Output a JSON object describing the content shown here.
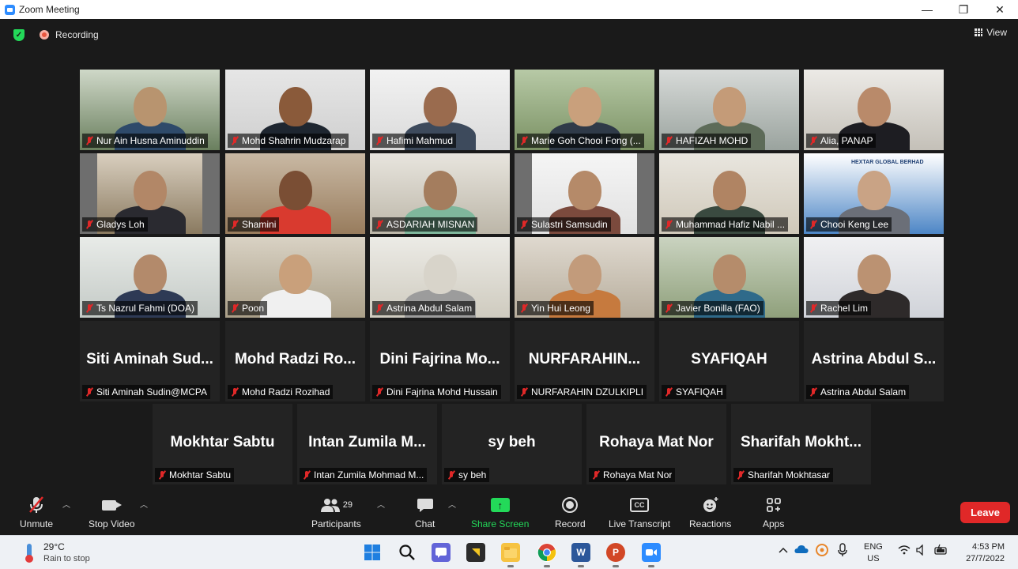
{
  "window": {
    "title": "Zoom Meeting",
    "minimize": "—",
    "maximize": "❐",
    "close": "✕"
  },
  "header": {
    "recording_label": "Recording",
    "view_label": "View"
  },
  "video_tiles": [
    {
      "name": "Nur Ain Husna Aminuddin",
      "active": true
    },
    {
      "name": "Mohd Shahrin Mudzarap"
    },
    {
      "name": "Hafimi Mahmud"
    },
    {
      "name": "Marie Goh Chooi Fong (..."
    },
    {
      "name": "HAFIZAH MOHD"
    },
    {
      "name": "Alia, PANAP"
    },
    {
      "name": "Gladys Loh"
    },
    {
      "name": "Shamini"
    },
    {
      "name": "ASDARIAH MISNAN"
    },
    {
      "name": "Sulastri Samsudin"
    },
    {
      "name": "Muhammad Hafiz Nabil ..."
    },
    {
      "name": "Chooi Keng Lee",
      "banner": "HEXTAR GLOBAL BERHAD"
    },
    {
      "name": "Ts Nazrul Fahmi (DOA)"
    },
    {
      "name": "Poon"
    },
    {
      "name": "Astrina Abdul Salam"
    },
    {
      "name": "Yin Hui Leong"
    },
    {
      "name": "Javier Bonilla (FAO)"
    },
    {
      "name": "Rachel Lim"
    }
  ],
  "name_tiles": [
    {
      "display": "Siti Aminah Sud...",
      "name": "Siti Aminah Sudin@MCPA"
    },
    {
      "display": "Mohd Radzi Ro...",
      "name": "Mohd Radzi Rozihad"
    },
    {
      "display": "Dini Fajrina Mo...",
      "name": "Dini Fajrina Mohd Hussain"
    },
    {
      "display": "NURFARAHIN...",
      "name": "NURFARAHIN DZULKIPLI"
    },
    {
      "display": "SYAFIQAH",
      "name": "SYAFIQAH"
    },
    {
      "display": "Astrina Abdul S...",
      "name": "Astrina Abdul Salam"
    },
    {
      "display": "Mokhtar Sabtu",
      "name": "Mokhtar Sabtu"
    },
    {
      "display": "Intan Zumila M...",
      "name": "Intan Zumila Mohmad M..."
    },
    {
      "display": "sy beh",
      "name": "sy beh"
    },
    {
      "display": "Rohaya Mat Nor",
      "name": "Rohaya Mat Nor"
    },
    {
      "display": "Sharifah Mokht...",
      "name": "Sharifah Mokhtasar"
    }
  ],
  "toolbar": {
    "unmute": "Unmute",
    "stop_video": "Stop Video",
    "participants": "Participants",
    "participants_count": "29",
    "chat": "Chat",
    "share_screen": "Share Screen",
    "record": "Record",
    "live_transcript": "Live Transcript",
    "reactions": "Reactions",
    "apps": "Apps",
    "leave": "Leave",
    "cc": "CC"
  },
  "taskbar": {
    "temperature": "29°C",
    "weather": "Rain to stop",
    "lang_top": "ENG",
    "lang_bottom": "US",
    "time": "4:53 PM",
    "date": "27/7/2022"
  },
  "colors": {
    "accent_green": "#23d959",
    "leave_red": "#e02828",
    "active_speaker": "#c8e13a",
    "zoom_blue": "#2d8cff"
  }
}
